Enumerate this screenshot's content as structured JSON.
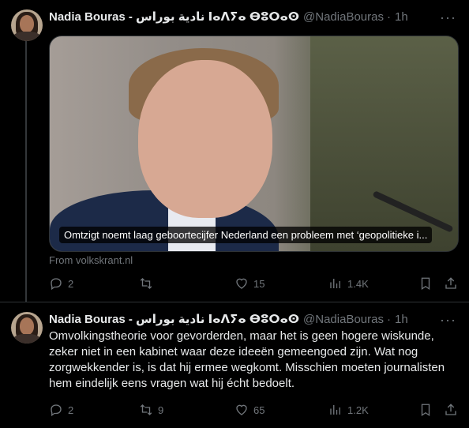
{
  "tweets": [
    {
      "author_name": "Nadia Bouras - نادية بوراس ⵏⴰⴷⵢⴰ ⴱⵓⵔⴰⵙ",
      "handle": "@NadiaBouras",
      "separator": "·",
      "time": "1h",
      "more_label": "···",
      "card": {
        "caption": "Omtzigt noemt laag geboortecijfer Nederland een probleem met ‘geopolitieke i...",
        "source": "From volkskrant.nl"
      },
      "stats": {
        "replies": "2",
        "retweets": "",
        "likes": "15",
        "views": "1.4K"
      }
    },
    {
      "author_name": "Nadia Bouras - نادية بوراس ⵏⴰⴷⵢⴰ ⴱⵓⵔⴰⵙ",
      "handle": "@NadiaBouras",
      "separator": "·",
      "time": "1h",
      "more_label": "···",
      "text": "Omvolkingstheorie voor gevorderden, maar het is geen hogere wiskunde, zeker niet in een kabinet waar deze ideeën gemeengoed zijn. Wat nog zorgwekkender is, is dat hij ermee wegkomt. Misschien moeten journalisten hem eindelijk eens vragen wat hij écht bedoelt.",
      "stats": {
        "replies": "2",
        "retweets": "9",
        "likes": "65",
        "views": "1.2K"
      }
    }
  ],
  "icons": {
    "reply": "reply-icon",
    "retweet": "retweet-icon",
    "like": "heart-icon",
    "views": "views-icon",
    "bookmark": "bookmark-icon",
    "share": "share-icon"
  },
  "colors": {
    "background": "#000000",
    "text": "#e7e9ea",
    "muted": "#71767b",
    "border": "#2f3336"
  }
}
